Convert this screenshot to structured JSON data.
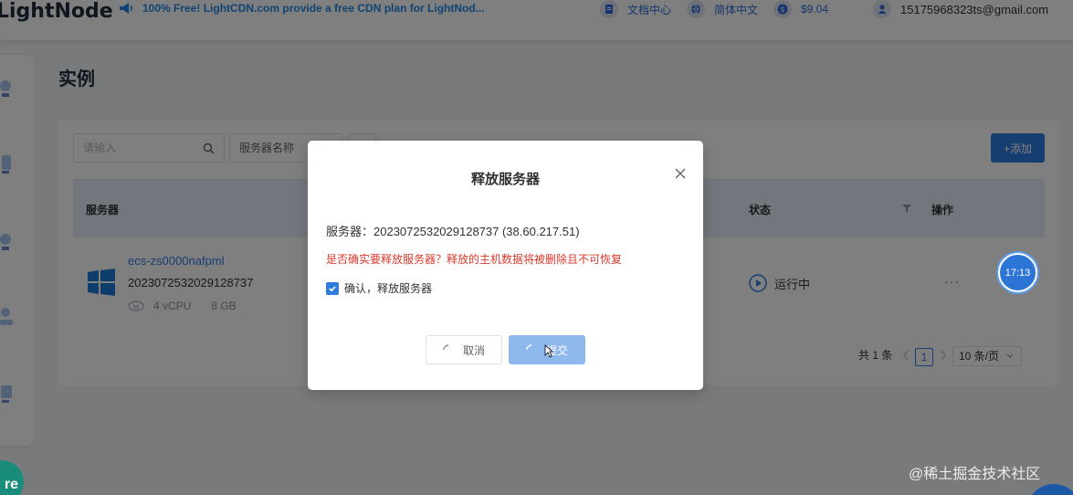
{
  "topbar": {
    "logo": "LightNode",
    "announcement": "100% Free! LightCDN.com provide a free CDN plan for LightNod...",
    "docs": "文档中心",
    "language": "简体中文",
    "balance": "$9.04",
    "user_email": "15175968323ts@gmail.com"
  },
  "page": {
    "title": "实例"
  },
  "toolbar": {
    "search_placeholder": "请输入",
    "filter_label": "服务器名称",
    "add_label": "+添加"
  },
  "table": {
    "headers": {
      "server": "服务器",
      "status": "状态",
      "actions": "操作"
    },
    "rows": [
      {
        "name": "ecs-zs0000nafpml",
        "id": "2023072532029128737",
        "cpu": "4 vCPU",
        "memory": "8 GB",
        "status": "运行中",
        "actions": "···"
      }
    ]
  },
  "pagination": {
    "total": "共 1 条",
    "current_page": "1",
    "page_size": "10 条/页"
  },
  "dialog": {
    "title": "释放服务器",
    "server_info": "服务器：2023072532029128737 (38.60.217.51)",
    "warning": "是否确实要释放服务器？释放的主机数据将被删除且不可恢复",
    "confirm_label": "确认，释放服务器",
    "confirm_checked": true,
    "cancel_label": "取消",
    "submit_label": "提交"
  },
  "clock": "17:13",
  "float_badge": "re",
  "watermark": "@稀土掘金技术社区",
  "colors": {
    "primary": "#2f7de1",
    "warning": "#d93a2b",
    "submit_disabled": "#8fb8ee"
  }
}
